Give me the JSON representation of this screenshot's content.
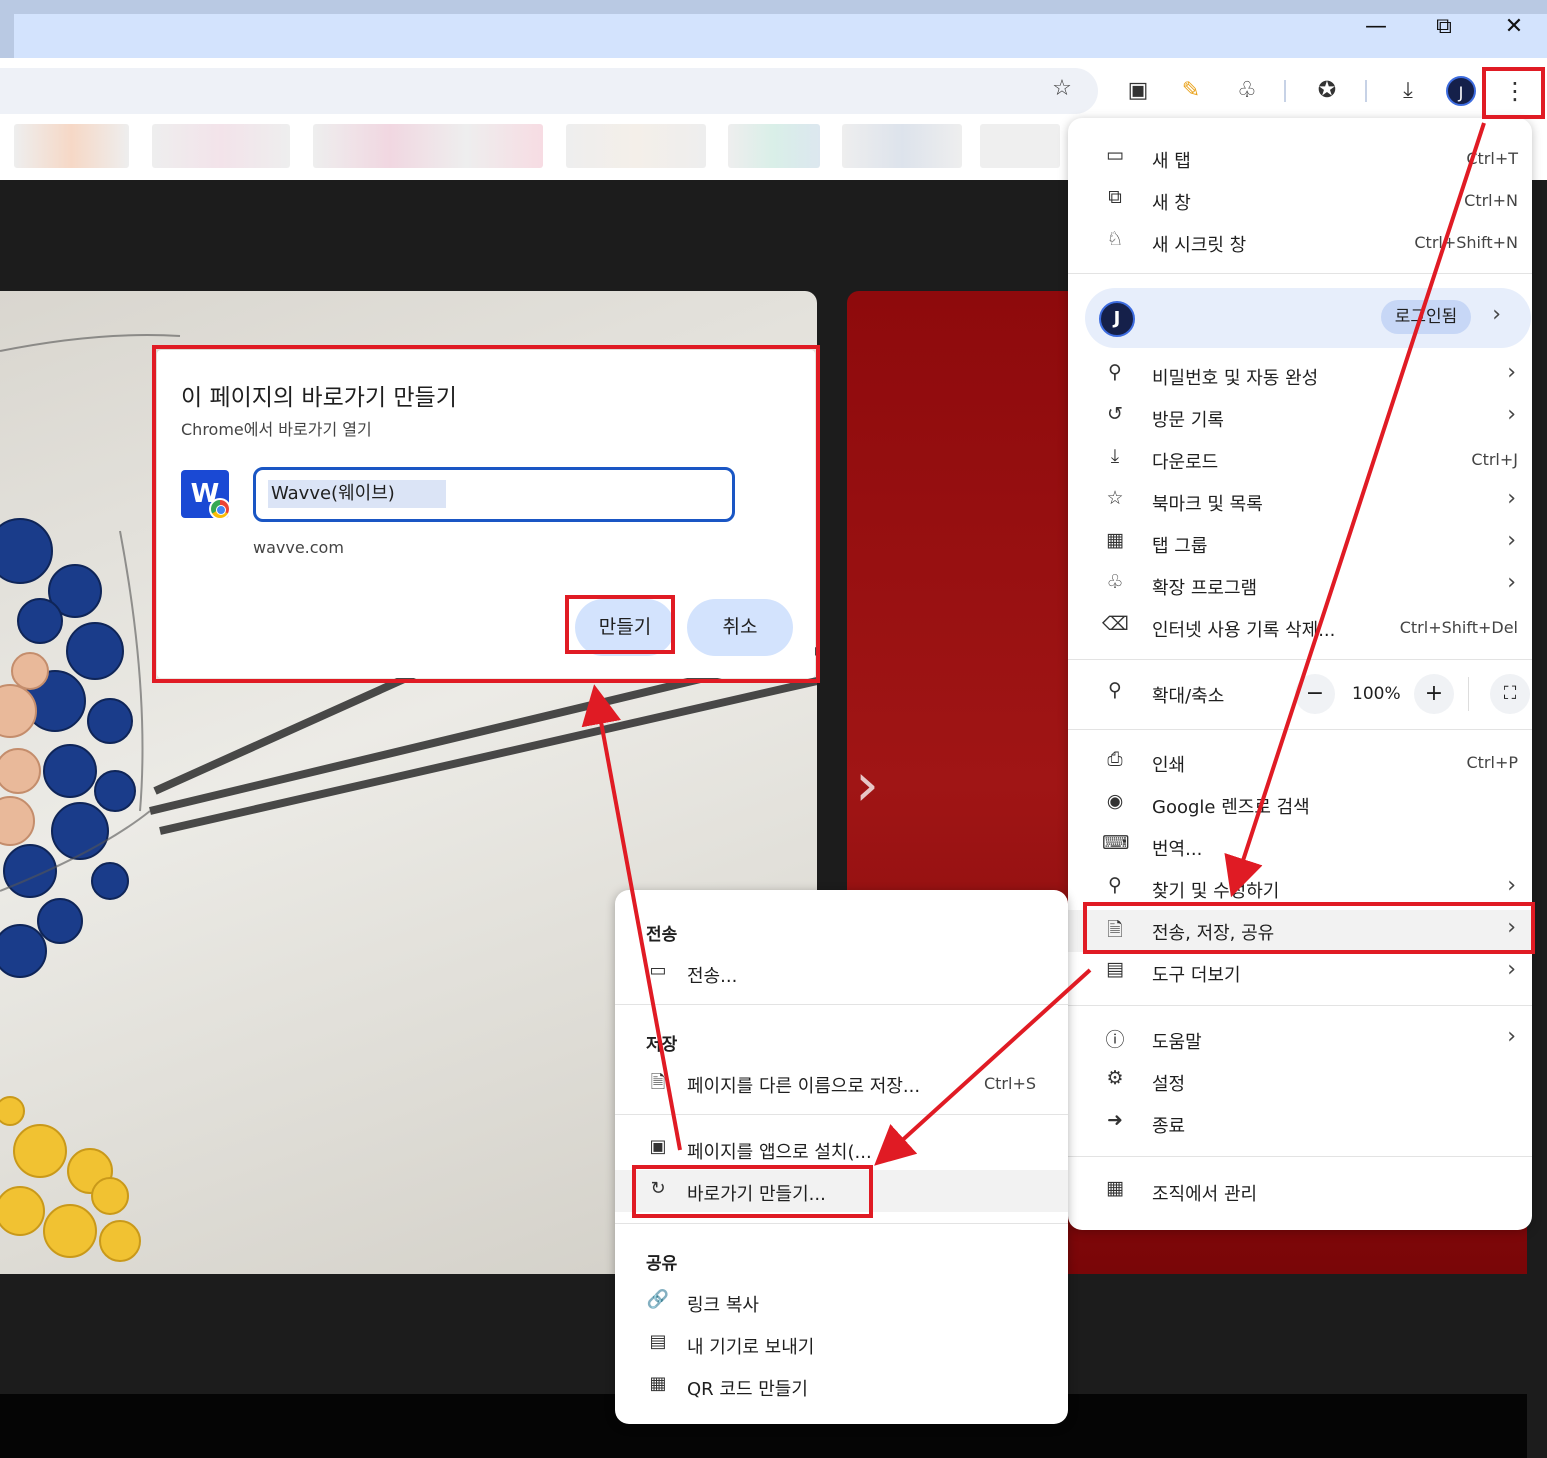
{
  "window": {
    "minimize_icon": "minimize-icon",
    "restore_icon": "restore-icon",
    "close_icon": "close-icon"
  },
  "toolbar": {
    "icons": [
      "star-icon",
      "picture-in-picture-icon",
      "note-icon",
      "extensions-icon",
      "favorites-icon",
      "download-icon",
      "profile-icon",
      "kebab-menu-icon"
    ]
  },
  "dialog": {
    "title": "이 페이지의 바로가기 만들기",
    "subtitle": "Chrome에서 바로가기 열기",
    "name_value": "Wavve(웨이브)",
    "url": "wavve.com",
    "create_label": "만들기",
    "cancel_label": "취소"
  },
  "menu": {
    "new_tab": {
      "label": "새 탭",
      "shortcut": "Ctrl+T"
    },
    "new_window": {
      "label": "새 창",
      "shortcut": "Ctrl+N"
    },
    "incognito": {
      "label": "새 시크릿 창",
      "shortcut": "Ctrl+Shift+N"
    },
    "profile_badge": "로그인됨",
    "passwords": {
      "label": "비밀번호 및 자동 완성"
    },
    "history": {
      "label": "방문 기록"
    },
    "downloads": {
      "label": "다운로드",
      "shortcut": "Ctrl+J"
    },
    "bookmarks": {
      "label": "북마크 및 목록"
    },
    "tab_groups": {
      "label": "탭 그룹"
    },
    "extensions": {
      "label": "확장 프로그램"
    },
    "clear_data": {
      "label": "인터넷 사용 기록 삭제...",
      "shortcut": "Ctrl+Shift+Del"
    },
    "zoom": {
      "label": "확대/축소",
      "minus": "−",
      "value": "100%",
      "plus": "+"
    },
    "print": {
      "label": "인쇄",
      "shortcut": "Ctrl+P"
    },
    "lens": {
      "label": "Google 렌즈로 검색"
    },
    "translate": {
      "label": "번역..."
    },
    "find_edit": {
      "label": "찾기 및 수정하기"
    },
    "cast_save_share": {
      "label": "전송, 저장, 공유"
    },
    "more_tools": {
      "label": "도구 더보기"
    },
    "help": {
      "label": "도움말"
    },
    "settings": {
      "label": "설정"
    },
    "exit": {
      "label": "종료"
    },
    "managed": {
      "label": "조직에서 관리"
    }
  },
  "submenu": {
    "cast_header": "전송",
    "cast": {
      "label": "전송..."
    },
    "save_header": "저장",
    "save_as": {
      "label": "페이지를 다른 이름으로 저장...",
      "shortcut": "Ctrl+S"
    },
    "install_app": {
      "label": "페이지를 앱으로 설치(..."
    },
    "create_shortcut": {
      "label": "바로가기 만들기..."
    },
    "share_header": "공유",
    "copy_link": {
      "label": "링크 복사"
    },
    "send_to_device": {
      "label": "내 기기로 보내기"
    },
    "qr_code": {
      "label": "QR 코드 만들기"
    }
  },
  "colors": {
    "highlight_red": "#e01b24",
    "button_blue": "#d3e3fd",
    "input_border": "#1a56c4"
  }
}
